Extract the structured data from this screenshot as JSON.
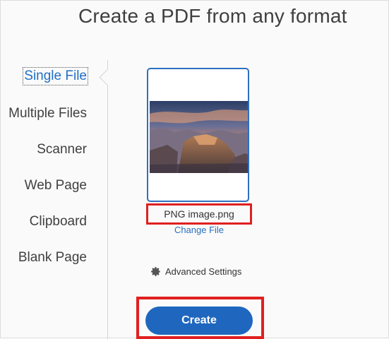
{
  "header": {
    "title": "Create a PDF from any format"
  },
  "sidebar": {
    "items": [
      {
        "label": "Single File",
        "active": true
      },
      {
        "label": "Multiple Files",
        "active": false
      },
      {
        "label": "Scanner",
        "active": false
      },
      {
        "label": "Web Page",
        "active": false
      },
      {
        "label": "Clipboard",
        "active": false
      },
      {
        "label": "Blank Page",
        "active": false
      }
    ]
  },
  "file": {
    "name": "PNG image.png",
    "change_label": "Change File"
  },
  "settings": {
    "advanced_label": "Advanced Settings",
    "icon": "gear-icon"
  },
  "actions": {
    "create_label": "Create"
  },
  "colors": {
    "accent": "#1f67be",
    "link": "#2a6fc0",
    "highlight": "#e02020"
  }
}
